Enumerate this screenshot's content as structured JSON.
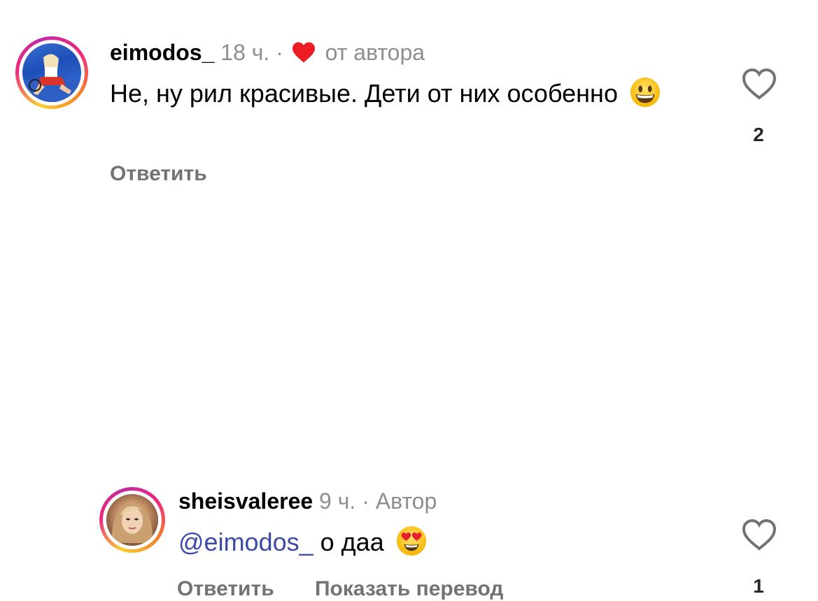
{
  "comments": [
    {
      "username": "eimodos_",
      "time": "18 ч.",
      "separator": "·",
      "badge": "от автора",
      "text": "Не, ну рил красивые. Дети от них особенно",
      "emoji": "grinning-face-emoji",
      "actions": {
        "reply": "Ответить"
      },
      "likes": "2"
    },
    {
      "username": "sheisvaleree",
      "time": "9 ч.",
      "separator": "·",
      "badge": "Автор",
      "mention": "@eimodos_",
      "text": "о даа",
      "emoji": "heart-eyes-emoji",
      "actions": {
        "reply": "Ответить",
        "translate": "Показать перевод"
      },
      "likes": "1"
    }
  ],
  "colors": {
    "username": "#000000",
    "meta": "#8e8e8e",
    "mention": "#3b4aa6",
    "actions": "#737373",
    "heart": "#ed1c24"
  }
}
